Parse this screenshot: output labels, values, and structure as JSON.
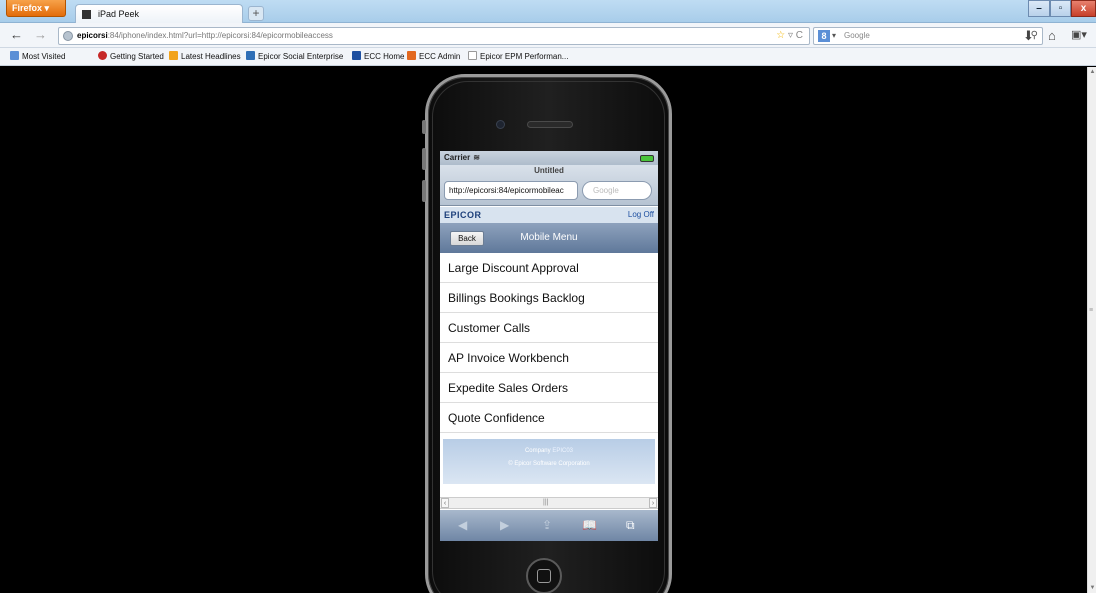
{
  "browser": {
    "menu_button": "Firefox",
    "tab_title": "iPad Peek",
    "new_tab": "+",
    "url_host": "epicorsi",
    "url_rest": ":84/iphone/index.html?url=http://epicorsi:84/epicormobileaccess",
    "search_engine_letter": "8",
    "search_placeholder": "Google",
    "win_minimize": "–",
    "win_restore": "▫",
    "win_close": "x",
    "bookmarks": [
      {
        "label": "Most Visited",
        "color": "#5b8fd6"
      },
      {
        "label": "Getting Started",
        "color": "#c62828"
      },
      {
        "label": "Latest Headlines",
        "color": "#f2a31b"
      },
      {
        "label": "Epicor Social Enterprise",
        "color": "#2f6fb6"
      },
      {
        "label": "ECC Home",
        "color": "#1d4fa0"
      },
      {
        "label": "ECC Admin",
        "color": "#e2681f"
      },
      {
        "label": "Epicor EPM Performan...",
        "color": "#ffffff"
      }
    ]
  },
  "phone": {
    "carrier": "Carrier",
    "page_title": "Untitled",
    "address": "http://epicorsi:84/epicormobileac",
    "search_placeholder": "Google",
    "brand": "EPICOR",
    "logoff": "Log Off",
    "back": "Back",
    "menu_title": "Mobile Menu",
    "menu_items": [
      "Large Discount Approval",
      "Billings Bookings Backlog",
      "Customer Calls",
      "AP Invoice Workbench",
      "Expedite Sales Orders",
      "Quote Confidence"
    ],
    "footer_company_label": "Company",
    "footer_company_value": "EPIC03",
    "footer_copyright": "© Epicor Software Corporation"
  },
  "icons": {
    "back_arrow": "◀",
    "forward_arrow": "▶",
    "share": "⇪",
    "bookmarks": "📖",
    "pages": "⧉",
    "wifi": "≋",
    "nav_back": "←",
    "nav_forward": "→",
    "star": "☆",
    "reload": "C",
    "download": "⬇",
    "home": "⌂",
    "search": "⚲"
  }
}
